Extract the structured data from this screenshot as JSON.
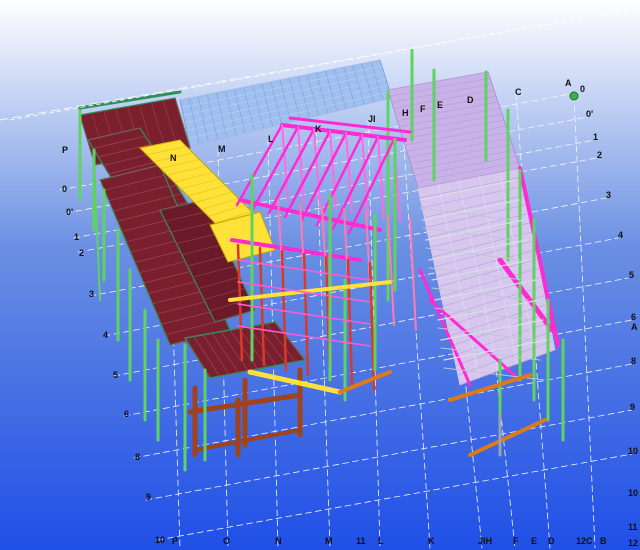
{
  "viewport": {
    "background_top": "#ffffff",
    "background_mid": "#6a8fe3",
    "background_bottom": "#1f4fe6"
  },
  "colors": {
    "column_green": "#5fd35f",
    "dark_green": "#2f8f5a",
    "grating_maroon": "#7a1f2e",
    "beam_magenta": "#ff2ad4",
    "beam_yellow": "#ffe13a",
    "deck_lightblue": "#9fc0ef",
    "deck_lavender": "#c9b2e8",
    "beam_orange": "#e07a16",
    "support_brown": "#a0421c",
    "beam_red": "#d83a28",
    "grid_line": "#f5f5f5"
  },
  "grid": {
    "left_axis": [
      "P",
      "0",
      "0'",
      "1",
      "2",
      "3",
      "4",
      "5",
      "6",
      "8",
      "9",
      "10"
    ],
    "back_top_axis": [
      "N",
      "M",
      "L",
      "K",
      "JI",
      "H",
      "F",
      "E",
      "D",
      "C",
      "B",
      "A"
    ],
    "right_axis": [
      "0",
      "0'",
      "1",
      "2",
      "3",
      "4",
      "5",
      "6",
      "A",
      "8",
      "9",
      "10",
      "11",
      "12"
    ],
    "bottom_axis": [
      "P",
      "O",
      "N",
      "M",
      "11",
      "L",
      "K",
      "JIH",
      "F",
      "E",
      "D",
      "12C",
      "B"
    ]
  },
  "view_cube": {
    "label": "A"
  }
}
